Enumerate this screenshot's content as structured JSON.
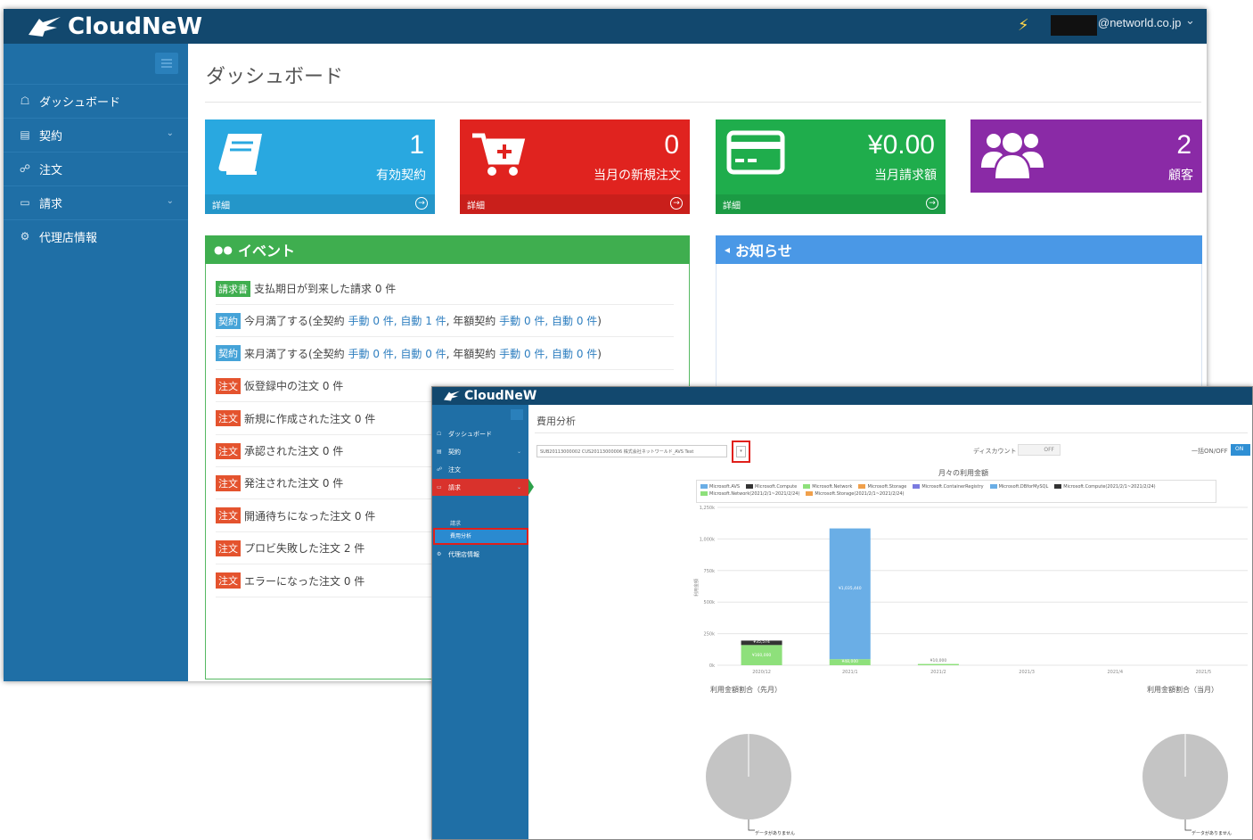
{
  "brand": "CloudNeW",
  "header": {
    "user_email": "@networld.co.jp"
  },
  "sidebar": {
    "items": [
      {
        "label": "ダッシュボード",
        "icon": "home-icon"
      },
      {
        "label": "契約",
        "icon": "book-icon"
      },
      {
        "label": "注文",
        "icon": "cart-icon"
      },
      {
        "label": "請求",
        "icon": "card-icon"
      },
      {
        "label": "代理店情報",
        "icon": "gears-icon"
      }
    ]
  },
  "page_title": "ダッシュボード",
  "cards": [
    {
      "value": "1",
      "label": "有効契約",
      "footer": "詳細",
      "color": "#29a8e0",
      "icon": "book-icon"
    },
    {
      "value": "0",
      "label": "当月の新規注文",
      "footer": "詳細",
      "color": "#e0231f",
      "icon": "cart-plus-icon"
    },
    {
      "value": "¥0.00",
      "label": "当月請求額",
      "footer": "詳細",
      "color": "#1fad4c",
      "icon": "credit-card-icon"
    },
    {
      "value": "2",
      "label": "顧客",
      "footer": "",
      "color": "#8a2aa6",
      "icon": "users-icon"
    }
  ],
  "events": {
    "title": "イベント",
    "rows": [
      {
        "badge": "請求書",
        "badge_color": "green",
        "parts": [
          "支払期日が到来した請求 0 件"
        ]
      },
      {
        "badge": "契約",
        "badge_color": "blue",
        "parts": [
          "今月満了する(全契約 ",
          "手動 0 件, 自動 1 件",
          ", 年額契約 ",
          "手動 0 件, 自動 0 件",
          ")"
        ]
      },
      {
        "badge": "契約",
        "badge_color": "blue",
        "parts": [
          "来月満了する(全契約 ",
          "手動 0 件, 自動 0 件",
          ", 年額契約 ",
          "手動 0 件, 自動 0 件",
          ")"
        ]
      },
      {
        "badge": "注文",
        "badge_color": "red",
        "parts": [
          "仮登録中の注文 0 件"
        ]
      },
      {
        "badge": "注文",
        "badge_color": "red",
        "parts": [
          "新規に作成された注文 0 件"
        ]
      },
      {
        "badge": "注文",
        "badge_color": "red",
        "parts": [
          "承認された注文 0 件"
        ]
      },
      {
        "badge": "注文",
        "badge_color": "red",
        "parts": [
          "発注された注文 0 件"
        ]
      },
      {
        "badge": "注文",
        "badge_color": "red",
        "parts": [
          "開通待ちになった注文 0 件"
        ]
      },
      {
        "badge": "注文",
        "badge_color": "red",
        "parts": [
          "プロビ失敗した注文 2 件"
        ]
      },
      {
        "badge": "注文",
        "badge_color": "red",
        "parts": [
          "エラーになった注文 0 件"
        ]
      }
    ]
  },
  "notices": {
    "title": "お知らせ"
  },
  "overlay": {
    "brand": "CloudNeW",
    "sidebar": [
      {
        "label": "ダッシュボード",
        "icon": "home-icon"
      },
      {
        "label": "契約",
        "icon": "book-icon"
      },
      {
        "label": "注文",
        "icon": "cart-icon"
      },
      {
        "label": "請求",
        "icon": "card-icon"
      },
      {
        "label": "代理店情報",
        "icon": "gears-icon"
      }
    ],
    "sub_billing": "請求",
    "sub_cost": "費用分析",
    "title": "費用分析",
    "select_value": "SUB20113000002 CUS20113000006 株式会社ネットワールド_AVS Test",
    "discount_label": "ディスカウント",
    "discount_state": "OFF",
    "bulk_label": "一括ON/OFF",
    "bulk_state": "ON",
    "chart_title": "月々の利用金額",
    "pie_prev_label": "利用金額割合（先月）",
    "pie_curr_label": "利用金額割合（当月）",
    "no_data": "データがありません"
  },
  "chart_data": {
    "type": "bar",
    "stacked": true,
    "title": "月々の利用金額",
    "ylabel": "利用金額",
    "categories": [
      "2020/12",
      "2021/1",
      "2021/2",
      "2021/3",
      "2021/4",
      "2021/5"
    ],
    "y_ticks": [
      "0k",
      "250k",
      "500k",
      "750k",
      "1,000k",
      "1,250k"
    ],
    "ylim": [
      0,
      1250000
    ],
    "legend": [
      {
        "name": "Microsoft.AVS",
        "color": "#6aaee6"
      },
      {
        "name": "Microsoft.Compute",
        "color": "#333333"
      },
      {
        "name": "Microsoft.Network",
        "color": "#8ee07b"
      },
      {
        "name": "Microsoft.Storage",
        "color": "#f0a04b"
      },
      {
        "name": "Microsoft.ContainerRegistry",
        "color": "#7b7be0"
      },
      {
        "name": "Microsoft.DBforMySQL",
        "color": "#6aaee6"
      },
      {
        "name": "Microsoft.Compute(2021/2/1~2021/2/24)",
        "color": "#333333"
      },
      {
        "name": "Microsoft.Network(2021/2/1~2021/2/24)",
        "color": "#8ee07b"
      },
      {
        "name": "Microsoft.Storage(2021/2/1~2021/2/24)",
        "color": "#f0a04b"
      }
    ],
    "series": [
      {
        "name": "Microsoft.AVS",
        "color": "#6aaee6",
        "values": [
          0,
          1035440,
          0,
          0,
          0,
          0
        ]
      },
      {
        "name": "Microsoft.Compute",
        "color": "#333333",
        "values": [
          35000,
          0,
          0,
          0,
          0,
          0
        ]
      },
      {
        "name": "Microsoft.Network",
        "color": "#8ee07b",
        "values": [
          160000,
          48000,
          10000,
          0,
          0,
          0
        ]
      }
    ],
    "data_labels": [
      "¥35,574",
      "¥160,000",
      "¥1,035,440",
      "¥48,000",
      "¥10,000"
    ]
  }
}
